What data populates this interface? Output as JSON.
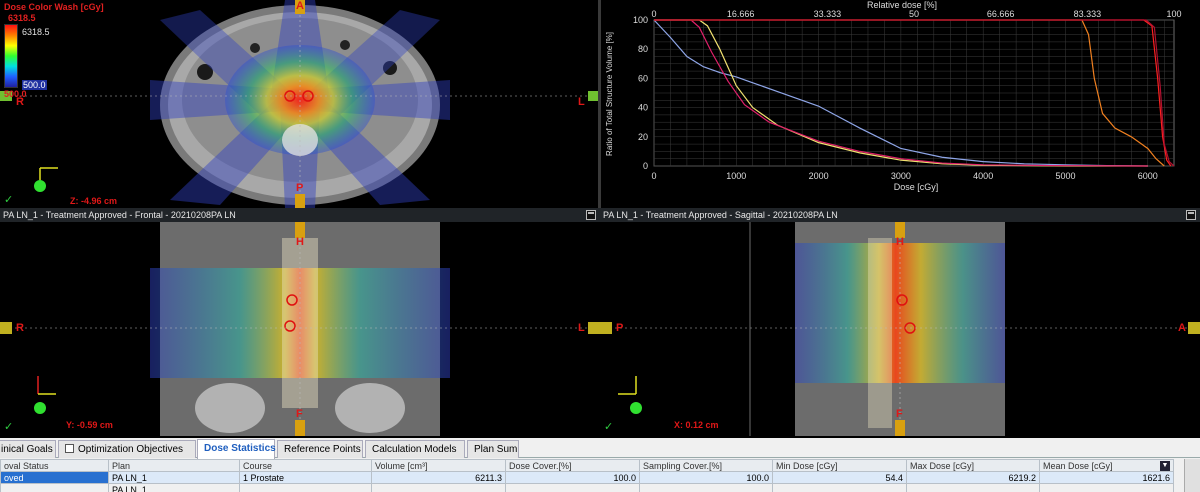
{
  "dose_legend": {
    "title": "Dose Color Wash [cGy]",
    "max": "6318.5",
    "max_marker": "6318.5",
    "min_marker": "500.0",
    "min": "500.0"
  },
  "axial": {
    "orient_top": "A",
    "orient_bottom": "P",
    "orient_left": "R",
    "orient_right": "L",
    "coord": "Z: -4.96 cm",
    "check": "✓"
  },
  "dvh": {
    "top_axis_label": "Relative dose [%]",
    "top_ticks": [
      "0",
      "16.666",
      "33.333",
      "50",
      "66.666",
      "83.333",
      "100"
    ],
    "y_label": "Ratio of Total Structure Volume [%]",
    "x_label": "Dose [cGy]",
    "x_ticks": [
      "0",
      "1000",
      "2000",
      "3000",
      "4000",
      "5000",
      "6000"
    ],
    "y_ticks": [
      "0",
      "20",
      "40",
      "60",
      "80",
      "100"
    ],
    "xlim": [
      0,
      6318.5
    ],
    "ylim": [
      0,
      100
    ],
    "colors": {
      "bg": "#000000",
      "grid": "#3c3c3c",
      "text": "#dddddd"
    }
  },
  "chart_data": {
    "type": "line",
    "title": "",
    "xlabel": "Dose [cGy]",
    "ylabel": "Ratio of Total Structure Volume [%]",
    "xlim": [
      0,
      6318.5
    ],
    "ylim": [
      0,
      100
    ],
    "grid": true,
    "series": [
      {
        "color": "#8fa6e8",
        "x": [
          0,
          200,
          400,
          600,
          800,
          1000,
          1200,
          1500,
          2000,
          2500,
          3000,
          3500,
          4000,
          4500,
          5000,
          5500,
          6000
        ],
        "y": [
          100,
          88,
          75,
          68,
          64,
          61,
          57,
          51,
          41,
          26,
          12,
          6,
          3,
          1.5,
          0.8,
          0.3,
          0
        ]
      },
      {
        "color": "#f0e070",
        "x": [
          0,
          550,
          650,
          800,
          1000,
          1200,
          1500,
          2000,
          2500,
          3000,
          3500,
          4000,
          5000,
          6000
        ],
        "y": [
          100,
          100,
          96,
          80,
          55,
          40,
          28,
          16,
          9,
          4,
          1.5,
          0.5,
          0,
          0
        ]
      },
      {
        "color": "#e0206a",
        "x": [
          0,
          450,
          550,
          700,
          900,
          1100,
          1400,
          2000,
          2500,
          3000,
          3500,
          4000,
          5000,
          5200,
          6000
        ],
        "y": [
          100,
          100,
          95,
          78,
          58,
          42,
          30,
          17,
          10,
          5,
          2,
          0.8,
          0.2,
          0.2,
          0
        ]
      },
      {
        "color": "#f08020",
        "x": [
          0,
          5200,
          5280,
          5350,
          5450,
          5600,
          5800,
          6000,
          6100,
          6200
        ],
        "y": [
          100,
          100,
          90,
          60,
          36,
          26,
          20,
          12,
          5,
          0
        ]
      },
      {
        "color": "#ff2020",
        "x": [
          0,
          5950,
          6050,
          6120,
          6180,
          6230,
          6280
        ],
        "y": [
          100,
          100,
          96,
          60,
          20,
          4,
          0
        ]
      },
      {
        "color": "#b01030",
        "x": [
          0,
          5980,
          6080,
          6150,
          6200,
          6260,
          6318
        ],
        "y": [
          100,
          100,
          95,
          55,
          15,
          3,
          0
        ]
      }
    ]
  },
  "frontal": {
    "title": "PA LN_1  -  Treatment Approved - Frontal - 20210208PA LN",
    "orient_top": "H",
    "orient_bottom": "F",
    "orient_left": "R",
    "orient_right": "L",
    "coord": "Y: -0.59 cm",
    "check": "✓"
  },
  "sagittal": {
    "title": "PA LN_1  -  Treatment Approved - Sagittal - 20210208PA LN",
    "orient_top": "H",
    "orient_bottom": "F",
    "orient_left": "P",
    "orient_right": "A",
    "coord": "X: 0.12 cm",
    "check": "✓"
  },
  "tabs": [
    {
      "label": "inical Goals"
    },
    {
      "label": "Optimization Objectives"
    },
    {
      "label": "Dose Statistics"
    },
    {
      "label": "Reference Points"
    },
    {
      "label": "Calculation Models"
    },
    {
      "label": "Plan Sum"
    }
  ],
  "table": {
    "headers": [
      "oval Status",
      "Plan",
      "Course",
      "Volume [cm³]",
      "Dose Cover.[%]",
      "Sampling Cover.[%]",
      "Min Dose [cGy]",
      "Max Dose [cGy]",
      "Mean Dose [cGy]"
    ],
    "rows": [
      [
        "oved",
        "PA LN_1",
        "1 Prostate",
        "6211.3",
        "100.0",
        "100.0",
        "54.4",
        "6219.2",
        "1621.6"
      ],
      [
        "",
        "PA LN_1",
        "",
        "",
        "",
        "",
        "",
        "",
        ""
      ]
    ]
  }
}
